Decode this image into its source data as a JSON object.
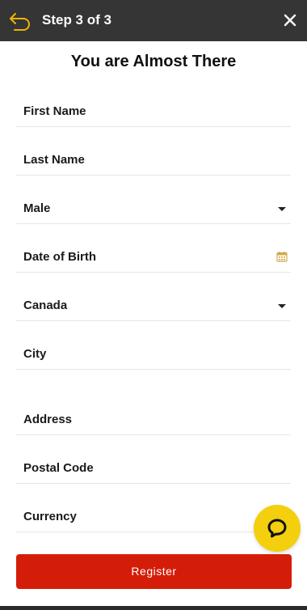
{
  "header": {
    "title": "Step 3 of 3",
    "back_icon": "back-arrow-icon",
    "close_icon": "close-icon",
    "background": "#353535",
    "accent": "#f0b400"
  },
  "form": {
    "heading": "You are Almost There",
    "fields": {
      "first_name": "First Name",
      "last_name": "Last Name",
      "gender": "Male",
      "date_of_birth": "Date of Birth",
      "country": "Canada",
      "city": "City",
      "address": "Address",
      "postal_code": "Postal Code",
      "currency": "Currency"
    },
    "calendar_icon": "calendar-icon",
    "dropdown_icon": "chevron-down-icon"
  },
  "actions": {
    "register_label": "Register",
    "register_color": "#d41d08"
  },
  "chat": {
    "icon": "chat-bubble-icon",
    "color": "#f3cf0e"
  }
}
